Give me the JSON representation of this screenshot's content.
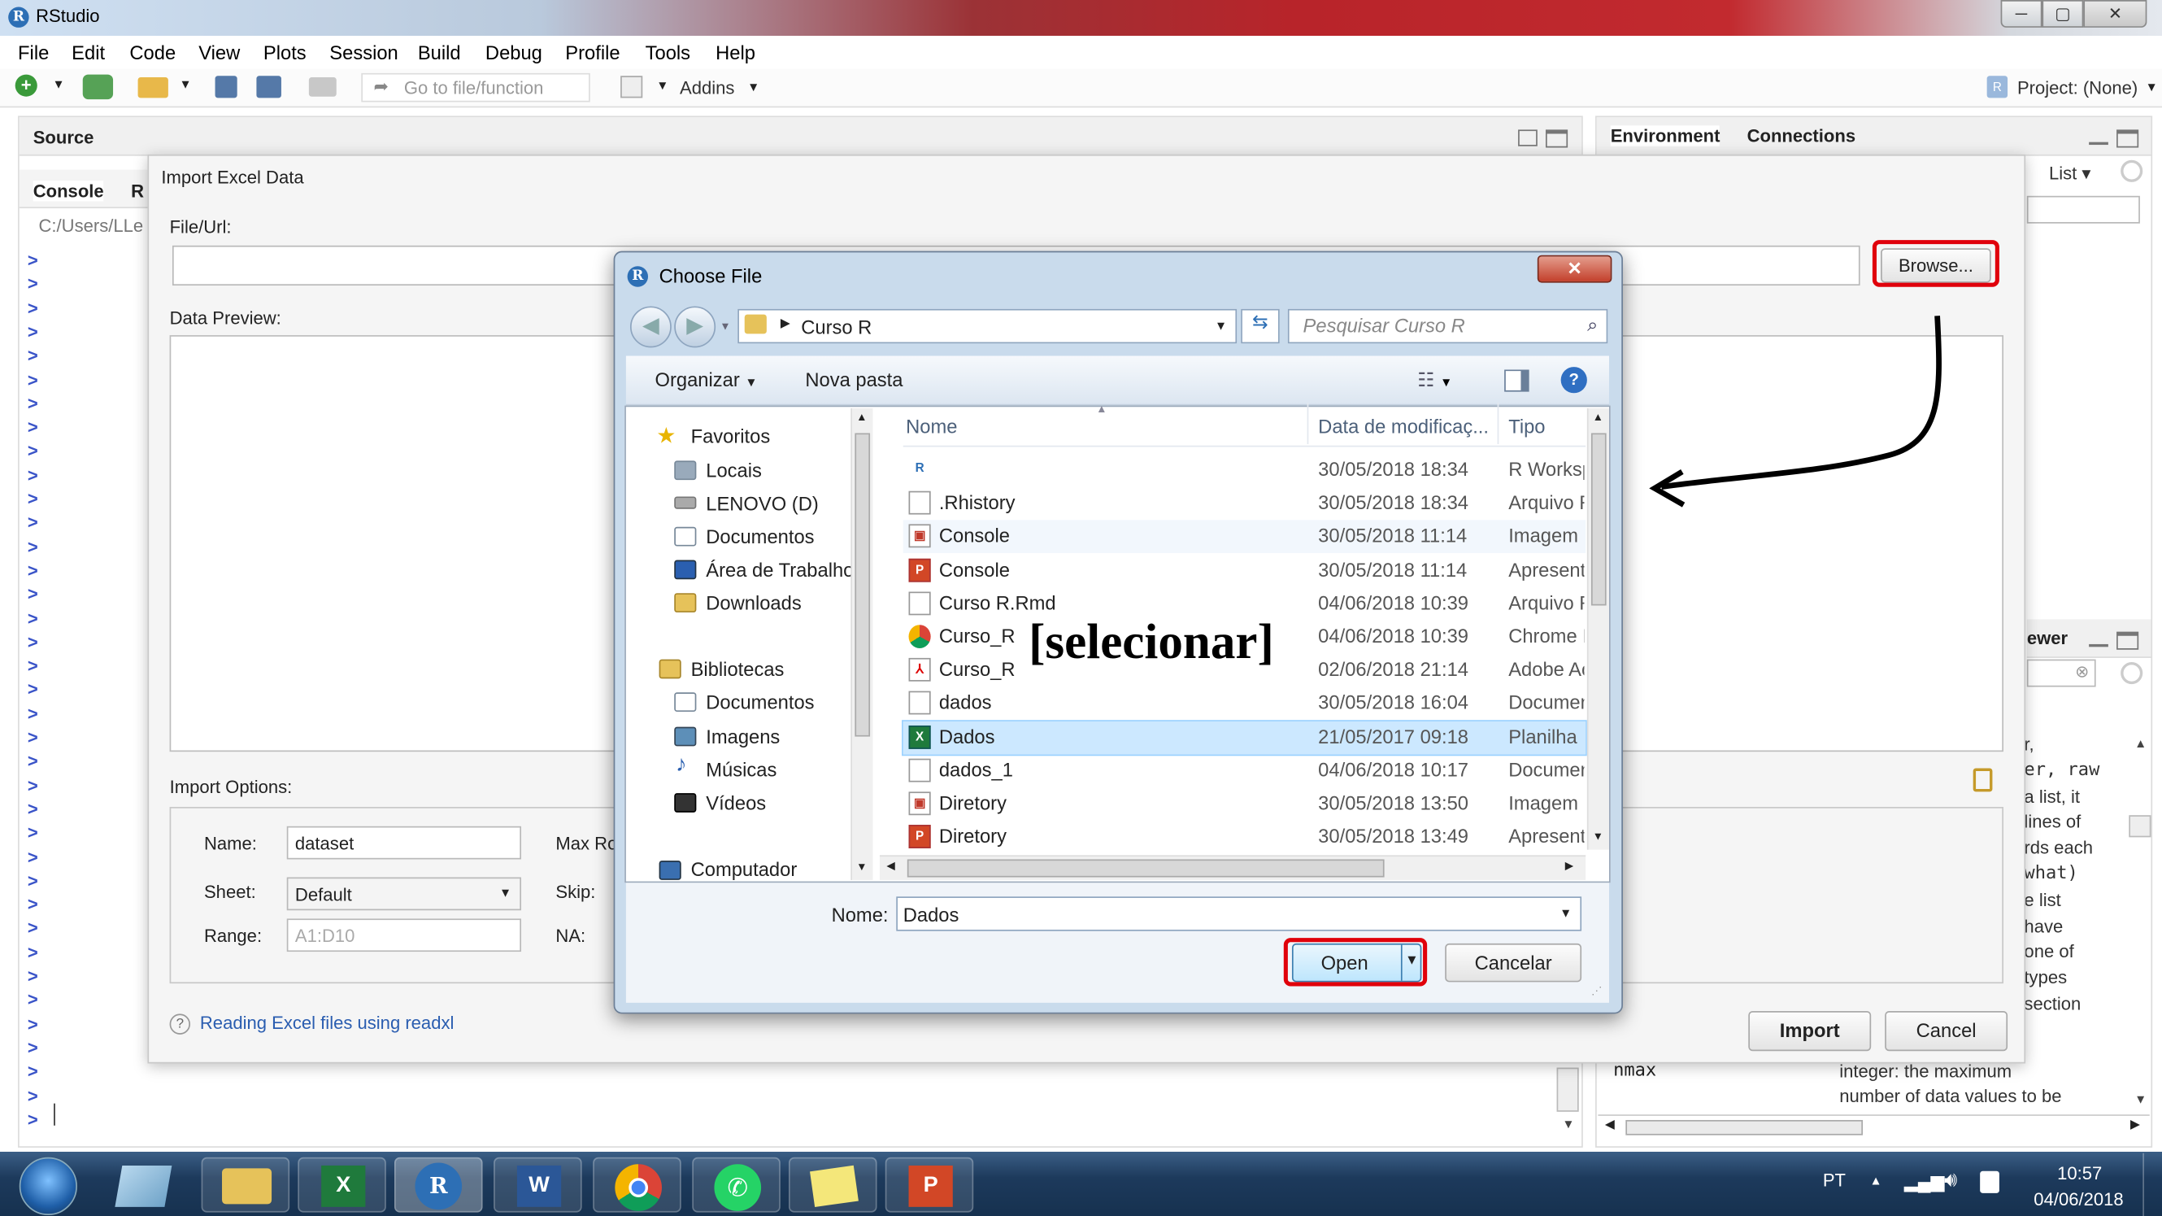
{
  "window": {
    "title": "RStudio"
  },
  "menu": [
    "File",
    "Edit",
    "Code",
    "View",
    "Plots",
    "Session",
    "Build",
    "Debug",
    "Profile",
    "Tools",
    "Help"
  ],
  "toolbar": {
    "goto": "Go to file/function",
    "addins": "Addins",
    "project": "Project: (None)"
  },
  "left_pane": {
    "source_tab": "Source",
    "console_tab": "Console",
    "r_tab": "R",
    "path": "C:/Users/LLe",
    "prompt": ">"
  },
  "right_pane": {
    "tabs": [
      "Environment",
      "Connections"
    ],
    "list_label": "List",
    "viewer_label": "ewer",
    "help_lines": [
      "r,",
      "er, raw",
      "a list, it",
      "lines of",
      "rds each",
      "what)",
      "e list",
      "have",
      "one of",
      "types",
      "section"
    ],
    "help_param": "nmax",
    "help_desc": [
      "integer: the maximum",
      "number of data values to be"
    ]
  },
  "import_dialog": {
    "title": "Import Excel Data",
    "file_label": "File/Url:",
    "browse": "Browse...",
    "preview_label": "Data Preview:",
    "options_label": "Import Options:",
    "name_label": "Name:",
    "name_value": "dataset",
    "sheet_label": "Sheet:",
    "sheet_value": "Default",
    "range_label": "Range:",
    "range_placeholder": "A1:D10",
    "max_label": "Max Ro",
    "skip_label": "Skip:",
    "na_label": "NA:",
    "help_link": "Reading Excel files using readxl",
    "import_btn": "Import",
    "cancel_btn": "Cancel"
  },
  "choose_file": {
    "title": "Choose File",
    "path": "Curso R",
    "search_placeholder": "Pesquisar Curso R",
    "organize": "Organizar",
    "new_folder": "Nova pasta",
    "nav": {
      "favorites": "Favoritos",
      "fav_items": [
        "Locais",
        "LENOVO (D)",
        "Documentos",
        "Área de Trabalho",
        "Downloads"
      ],
      "libraries": "Bibliotecas",
      "lib_items": [
        "Documentos",
        "Imagens",
        "Músicas",
        "Vídeos"
      ],
      "computer": "Computador"
    },
    "columns": {
      "name": "Nome",
      "date": "Data de modificaç...",
      "type": "Tipo"
    },
    "files": [
      {
        "name": "",
        "date": "30/05/2018 18:34",
        "type": "R Workspace",
        "icon": "r-workspace-icon"
      },
      {
        "name": ".Rhistory",
        "date": "30/05/2018 18:34",
        "type": "Arquivo RHISTORY",
        "icon": "file-icon"
      },
      {
        "name": "Console",
        "date": "30/05/2018 11:14",
        "type": "Imagem",
        "icon": "image-icon"
      },
      {
        "name": "Console",
        "date": "30/05/2018 11:14",
        "type": "Apresentação",
        "icon": "powerpoint-icon"
      },
      {
        "name": "Curso R.Rmd",
        "date": "04/06/2018 10:39",
        "type": "Arquivo RMD",
        "icon": "file-icon"
      },
      {
        "name": "Curso_R",
        "date": "04/06/2018 10:39",
        "type": "Chrome HTML",
        "icon": "chrome-icon"
      },
      {
        "name": "Curso_R",
        "date": "02/06/2018 21:14",
        "type": "Adobe Acrobat",
        "icon": "pdf-icon"
      },
      {
        "name": "dados",
        "date": "30/05/2018 16:04",
        "type": "Documento",
        "icon": "file-icon"
      },
      {
        "name": "Dados",
        "date": "21/05/2017 09:18",
        "type": "Planilha",
        "icon": "excel-icon"
      },
      {
        "name": "dados_1",
        "date": "04/06/2018 10:17",
        "type": "Documento",
        "icon": "file-icon"
      },
      {
        "name": "Diretory",
        "date": "30/05/2018 13:50",
        "type": "Imagem",
        "icon": "image-icon"
      },
      {
        "name": "Diretory",
        "date": "30/05/2018 13:49",
        "type": "Apresentação",
        "icon": "powerpoint-icon"
      }
    ],
    "filename_label": "Nome:",
    "filename_value": "Dados",
    "open": "Open",
    "cancel": "Cancelar"
  },
  "annotation": {
    "text": "[selecionar]"
  },
  "taskbar": {
    "lang": "PT",
    "time": "10:57",
    "date": "04/06/2018"
  }
}
